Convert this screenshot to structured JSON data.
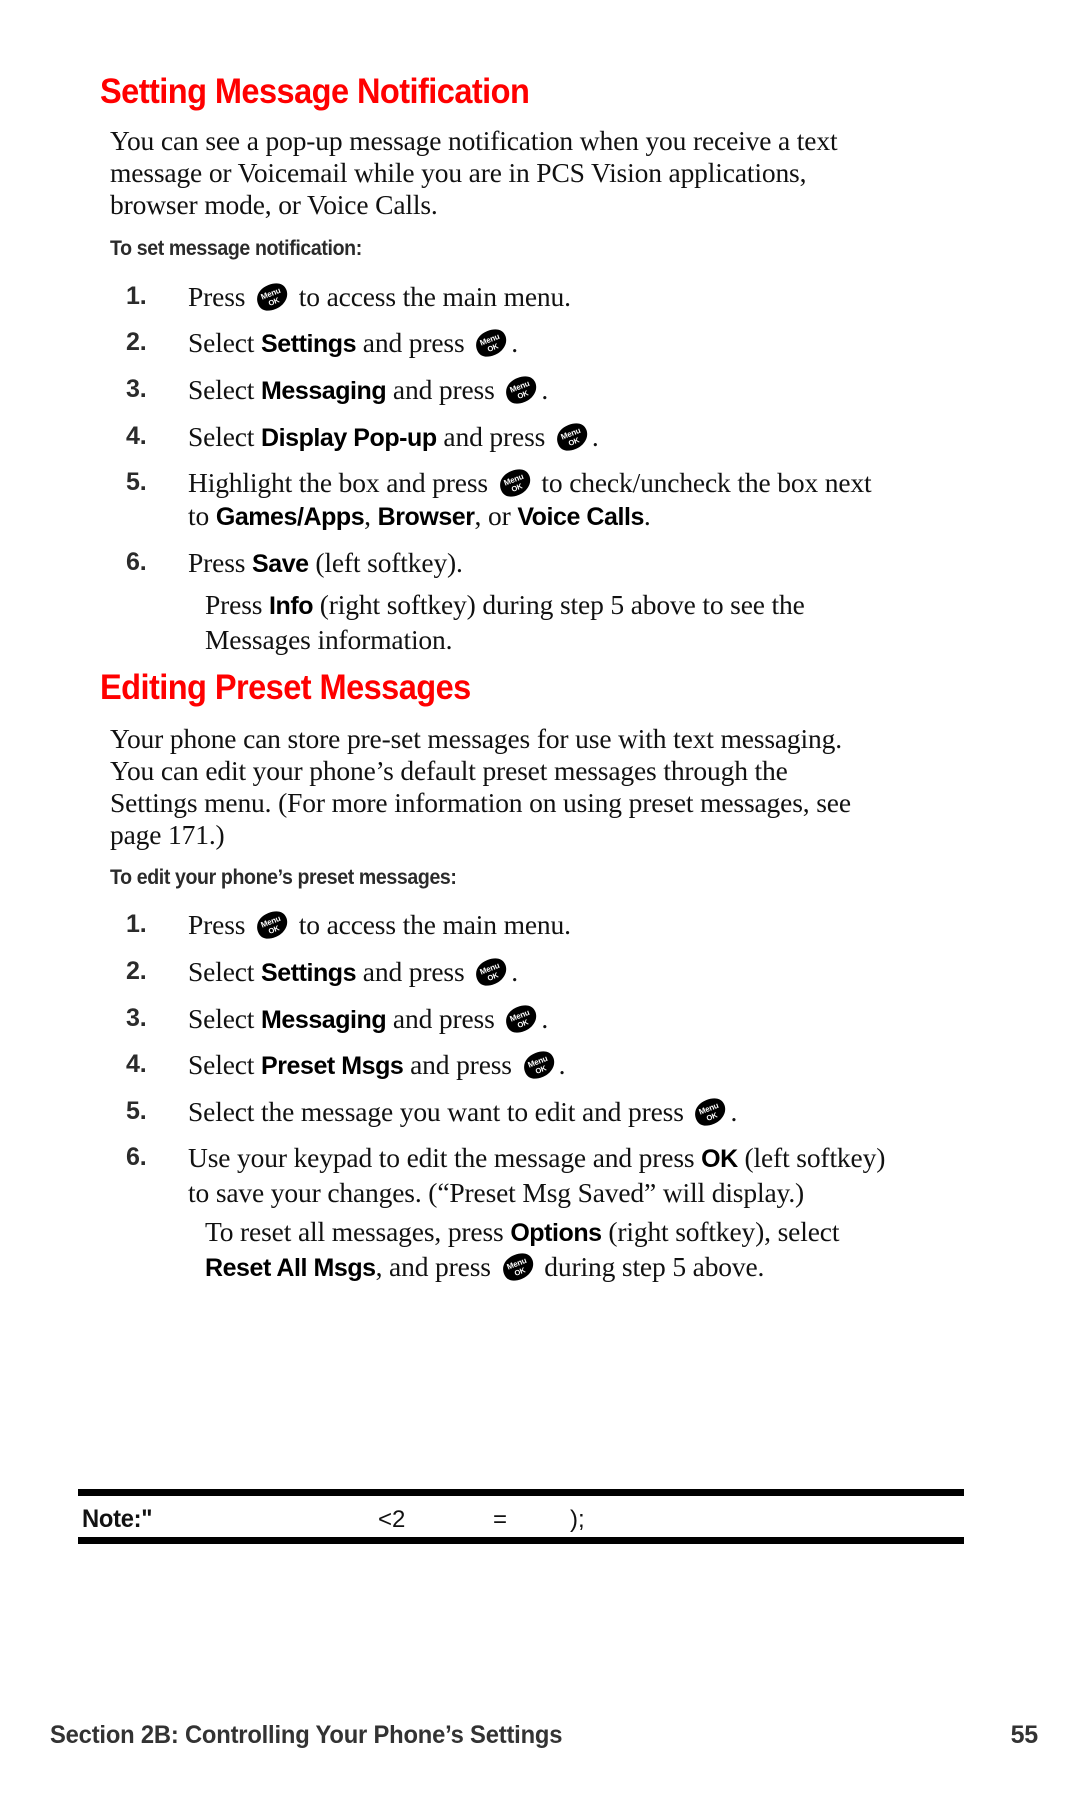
{
  "page": {
    "heading_color": "#ff0000",
    "text_color": "#111111",
    "background": "#ffffff"
  },
  "icons": {
    "menu_ok_key": {
      "name": "menu-ok-key-icon",
      "top_label": "Menu",
      "bottom_label": "OK"
    }
  },
  "sections": [
    {
      "heading": "Setting Message Notification",
      "intro": {
        "lines": [
          "You can see a pop-up message notification when you receive a text",
          "message or Voicemail while you are in PCS Vision applications,",
          "browser mode, or Voice Calls."
        ]
      },
      "subheading": "To set message notification:",
      "steps": [
        {
          "number": "1.",
          "lines": [
            "Press ① to access the main menu."
          ]
        },
        {
          "number": "2.",
          "lines": [
            "Select Settings and press ①."
          ]
        },
        {
          "number": "3.",
          "lines": [
            "Select Messaging and press ①."
          ]
        },
        {
          "number": "4.",
          "lines": [
            "Select Display Pop-up and press ①."
          ]
        },
        {
          "number": "5.",
          "lines": [
            "Highlight the box and press ① to check/uncheck the box next",
            "to Games/Apps, Browser, or Voice Calls."
          ]
        },
        {
          "number": "6.",
          "lines": [
            "Press Save (left softkey)."
          ]
        }
      ],
      "note_paragraph": {
        "lines": [
          "Press Info (right softkey) during step 5 above to see the",
          "Messages information."
        ]
      }
    },
    {
      "heading": "Editing Preset Messages",
      "intro": {
        "lines": [
          "Your phone can store pre-set messages for use with text messaging.",
          "You can edit your phone’s default preset messages through the",
          "Settings menu. (For more information on using preset messages, see",
          "page 171.)"
        ]
      },
      "subheading": "To edit your phone’s preset messages:",
      "steps": [
        {
          "number": "1.",
          "lines": [
            "Press ① to access the main menu."
          ]
        },
        {
          "number": "2.",
          "lines": [
            "Select Settings and press ①."
          ]
        },
        {
          "number": "3.",
          "lines": [
            "Select Messaging and press ①."
          ]
        },
        {
          "number": "4.",
          "lines": [
            "Select Preset Msgs and press ①."
          ]
        },
        {
          "number": "5.",
          "lines": [
            "Select the message you want to edit and press ①."
          ]
        },
        {
          "number": "6.",
          "lines": [
            "Use your keypad to edit the message and press OK (left softkey)",
            "to save your changes. (“Preset Msg Saved” will display.)"
          ]
        }
      ],
      "note_paragraph": {
        "lines": [
          "To reset all messages, press Options (right softkey), select",
          "Reset All Msgs, and press ① during step 5 above."
        ]
      }
    }
  ],
  "note_box": {
    "label": "Note:\"",
    "fragments": [
      "<2",
      "=",
      ");"
    ]
  },
  "footer": {
    "title": "Section 2B: Controlling Your Phone’s Settings",
    "page_number": "55"
  },
  "text": {
    "s1_intro_l1": "You can see a pop-up message notification when you receive a text",
    "s1_intro_l2": "message or Voicemail while you are in PCS Vision applications,",
    "s1_intro_l3": "browser mode, or Voice Calls.",
    "s1_sub": "To set message notification:",
    "s1_n1": "1.",
    "s1_n2": "2.",
    "s1_n3": "3.",
    "s1_n4": "4.",
    "s1_n5": "5.",
    "s1_n6": "6.",
    "s1_1a": "Press ",
    "s1_1b": " to access the main menu.",
    "s1_2a": "Select ",
    "s1_2b": "Settings",
    "s1_2c": " and press ",
    "s1_2d": ".",
    "s1_3a": "Select ",
    "s1_3b": "Messaging",
    "s1_3c": " and press ",
    "s1_3d": ".",
    "s1_4a": "Select ",
    "s1_4b": "Display Pop-up",
    "s1_4c": " and press ",
    "s1_4d": ".",
    "s1_5a": "Highlight the box and press ",
    "s1_5b": " to check/uncheck the box next",
    "s1_5c": "to ",
    "s1_5d": "Games/Apps",
    "s1_5e": ", ",
    "s1_5f": "Browser",
    "s1_5g": ", or ",
    "s1_5h": "Voice Calls",
    "s1_5i": ".",
    "s1_6a": "Press ",
    "s1_6b": "Save",
    "s1_6c": " (left softkey).",
    "s1_note_a": "Press ",
    "s1_note_b": "Info",
    "s1_note_c": " (right softkey) during step 5 above to see the",
    "s1_note_d": "Messages information.",
    "s2_intro_l1": "Your phone can store pre-set messages for use with text messaging.",
    "s2_intro_l2": "You can edit your phone’s default preset messages through the",
    "s2_intro_l3": "Settings menu. (For more information on using preset messages, see",
    "s2_intro_l4": "page 171.)",
    "s2_sub": "To edit your phone’s preset messages:",
    "s2_n1": "1.",
    "s2_n2": "2.",
    "s2_n3": "3.",
    "s2_n4": "4.",
    "s2_n5": "5.",
    "s2_n6": "6.",
    "s2_1a": "Press ",
    "s2_1b": " to access the main menu.",
    "s2_2a": "Select ",
    "s2_2b": "Settings",
    "s2_2c": " and press ",
    "s2_2d": ".",
    "s2_3a": "Select ",
    "s2_3b": "Messaging",
    "s2_3c": " and press ",
    "s2_3d": ".",
    "s2_4a": "Select ",
    "s2_4b": "Preset Msgs",
    "s2_4c": " and press ",
    "s2_4d": ".",
    "s2_5a": "Select the message you want to edit and press ",
    "s2_5b": ".",
    "s2_6a": "Use your keypad to edit the message and press ",
    "s2_6b": "OK",
    "s2_6c": " (left softkey)",
    "s2_6d": "to save your changes. (“Preset Msg Saved” will display.)",
    "s2_note_a": "To reset all messages, press ",
    "s2_note_b": "Options",
    "s2_note_c": " (right softkey), select",
    "s2_note_d": "Reset All Msgs",
    "s2_note_e": ", and press ",
    "s2_note_f": " during step 5 above."
  }
}
